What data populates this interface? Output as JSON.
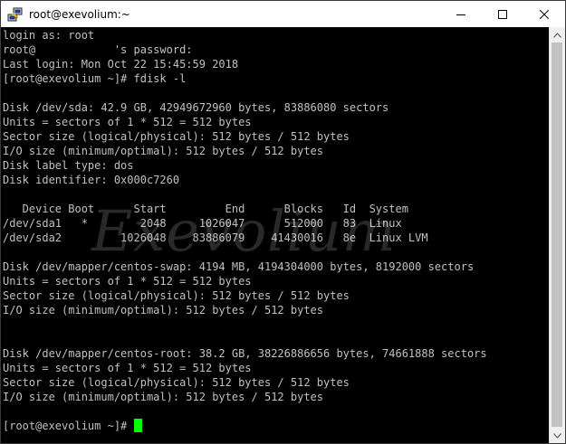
{
  "window": {
    "title": "root@exevolium:~",
    "icon": "putty-icon",
    "controls": {
      "minimize_icon": "minimize-icon",
      "maximize_icon": "maximize-icon",
      "close_icon": "close-icon"
    }
  },
  "terminal": {
    "text_color": "#c0c0c0",
    "background": "#000000",
    "cursor_color": "#00ff00",
    "lines": [
      "login as: root",
      "root@            's password:",
      "Last login: Mon Oct 22 15:45:59 2018",
      "[root@exevolium ~]# fdisk -l",
      "",
      "Disk /dev/sda: 42.9 GB, 42949672960 bytes, 83886080 sectors",
      "Units = sectors of 1 * 512 = 512 bytes",
      "Sector size (logical/physical): 512 bytes / 512 bytes",
      "I/O size (minimum/optimal): 512 bytes / 512 bytes",
      "Disk label type: dos",
      "Disk identifier: 0x000c7260",
      "",
      "   Device Boot      Start         End      Blocks   Id  System",
      "/dev/sda1   *        2048     1026047      512000   83  Linux",
      "/dev/sda2         1026048    83886079    41430016   8e  Linux LVM",
      "",
      "Disk /dev/mapper/centos-swap: 4194 MB, 4194304000 bytes, 8192000 sectors",
      "Units = sectors of 1 * 512 = 512 bytes",
      "Sector size (logical/physical): 512 bytes / 512 bytes",
      "I/O size (minimum/optimal): 512 bytes / 512 bytes",
      "",
      "",
      "Disk /dev/mapper/centos-root: 38.2 GB, 38226886656 bytes, 74661888 sectors",
      "Units = sectors of 1 * 512 = 512 bytes",
      "Sector size (logical/physical): 512 bytes / 512 bytes",
      "I/O size (minimum/optimal): 512 bytes / 512 bytes",
      "",
      "[root@exevolium ~]# "
    ]
  },
  "watermark": "Exevolium"
}
